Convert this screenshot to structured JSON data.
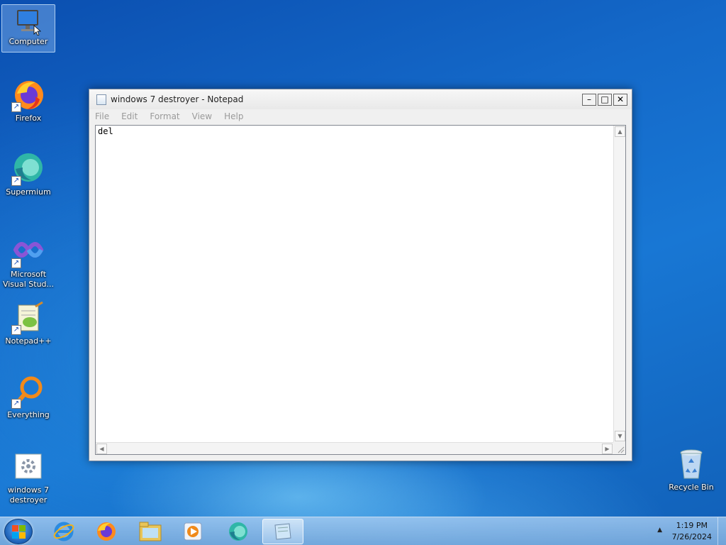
{
  "desktop": {
    "icons": [
      {
        "label": "Computer",
        "icon": "computer-icon"
      },
      {
        "label": "Firefox",
        "icon": "firefox-icon"
      },
      {
        "label": "Supermium",
        "icon": "supermium-icon"
      },
      {
        "label": "Microsoft Visual Stud...",
        "icon": "visual-studio-icon"
      },
      {
        "label": "Notepad++",
        "icon": "notepadplusplus-icon"
      },
      {
        "label": "Everything",
        "icon": "everything-icon"
      },
      {
        "label": "windows 7 destroyer",
        "icon": "batch-file-icon"
      },
      {
        "label": "Recycle Bin",
        "icon": "recycle-bin-icon"
      }
    ]
  },
  "notepad": {
    "title": "windows 7 destroyer - Notepad",
    "menu": [
      "File",
      "Edit",
      "Format",
      "View",
      "Help"
    ],
    "content": "del",
    "controls": {
      "minimize": "–",
      "maximize": "□",
      "close": "✕"
    }
  },
  "taskbar": {
    "apps": [
      "internet-explorer-icon",
      "firefox-icon",
      "file-explorer-icon",
      "media-player-icon",
      "supermium-icon",
      "notepad-icon"
    ],
    "active_app": "notepad-icon",
    "tray_arrow": "▲",
    "clock_time": "1:19 PM",
    "clock_date": "7/26/2024"
  },
  "colors": {
    "accent": "#1877d4",
    "window_border": "#7a8aa0"
  }
}
